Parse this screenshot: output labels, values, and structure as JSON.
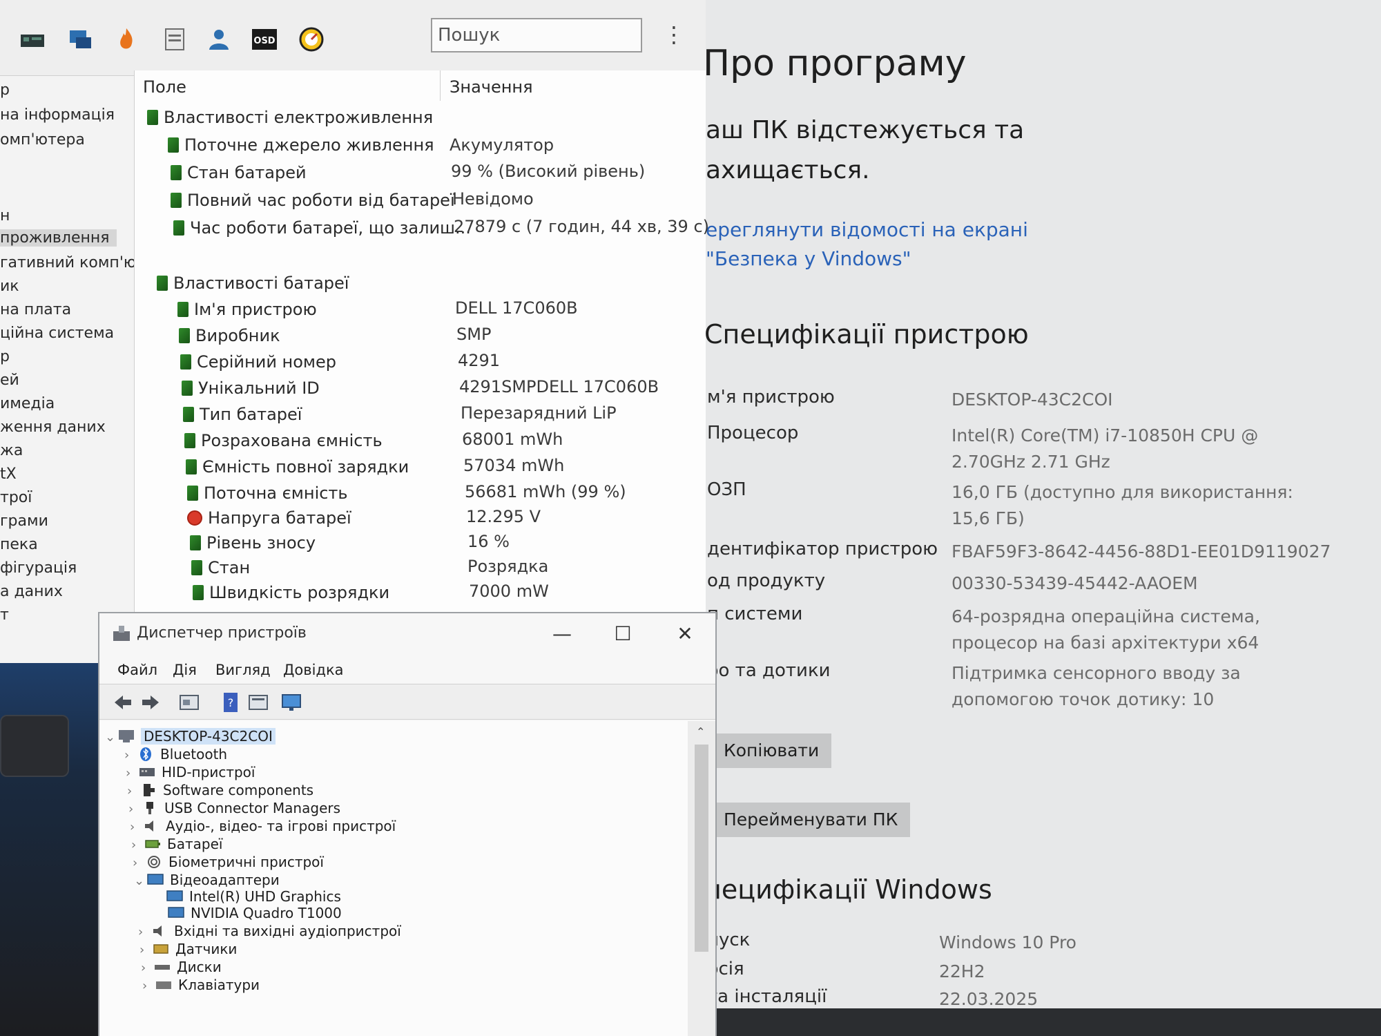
{
  "aida": {
    "search_placeholder": "Пошук",
    "nav": [
      "р",
      "на інформація",
      "омп'ютера",
      "н",
      "проживлення",
      "гативний комп'юте",
      "ик",
      "на плата",
      "ційна система",
      "р",
      "ей",
      "имедіа",
      "ження даних",
      "жа",
      "tX",
      "трої",
      "грами",
      "пека",
      "фігурація",
      "а даних",
      "т"
    ],
    "columns": {
      "field": "Поле",
      "value": "Значення"
    },
    "groups": [
      {
        "title": "Властивості електроживлення",
        "rows": [
          {
            "field": "Поточне джерело живлення",
            "value": "Акумулятор"
          },
          {
            "field": "Стан батарей",
            "value": "99 % (Високий рівень)"
          },
          {
            "field": "Повний час роботи від батареї",
            "value": "Невідомо"
          },
          {
            "field": "Час роботи батареї, що залиш...",
            "value": "27879 с (7 годин, 44 хв, 39 с)"
          }
        ]
      },
      {
        "title": "Властивості батареї",
        "rows": [
          {
            "field": "Ім'я пристрою",
            "value": "DELL 17C060B"
          },
          {
            "field": "Виробник",
            "value": "SMP"
          },
          {
            "field": "Серійний номер",
            "value": "4291"
          },
          {
            "field": "Унікальний ID",
            "value": "4291SMPDELL 17C060B"
          },
          {
            "field": "Тип батареї",
            "value": "Перезарядний LiP"
          },
          {
            "field": "Розрахована ємність",
            "value": "68001 mWh"
          },
          {
            "field": "Ємність повної зарядки",
            "value": "57034 mWh"
          },
          {
            "field": "Поточна ємність",
            "value": "56681 mWh  (99 %)"
          },
          {
            "field": "Напруга батареї",
            "value": "12.295 V"
          },
          {
            "field": "Рівень зносу",
            "value": "16 %"
          },
          {
            "field": "Стан",
            "value": "Розрядка"
          },
          {
            "field": "Швидкість розрядки",
            "value": "7000 mW"
          }
        ]
      }
    ]
  },
  "devmgr": {
    "title": "Диспетчер пристроїв",
    "menu": [
      "Файл",
      "Дія",
      "Вигляд",
      "Довідка"
    ],
    "root": "DESKTOP-43C2COI",
    "nodes": [
      "Bluetooth",
      "HID-пристрої",
      "Software components",
      "USB Connector Managers",
      "Аудіо-, відео- та ігрові пристрої",
      "Батареї",
      "Біометричні пристрої",
      "Відеоадаптери",
      "Intel(R) UHD Graphics",
      "NVIDIA Quadro T1000",
      "Вхідні та вихідні аудіопристрої",
      "Датчики",
      "Диски",
      "Клавіатури"
    ]
  },
  "settings": {
    "title": "Про програму",
    "protection": "аш ПК відстежується та ахищається.",
    "link": "ереглянути відомості на екрані \"Безпека у Vindows\"",
    "device_specs_title": "Специфікації пристрою",
    "specs": [
      {
        "label": "м'я пристрою",
        "value": "DESKTOP-43C2COI"
      },
      {
        "label": "Процесор",
        "value": "Intel(R) Core(TM) i7-10850H CPU @ 2.70GHz   2.71 GHz"
      },
      {
        "label": "ОЗП",
        "value": "16,0 ГБ (доступно для використання: 15,6 ГБ)"
      },
      {
        "label": "дентифікатор пристрою",
        "value": "FBAF59F3-8642-4456-88D1-EE01D9119027"
      },
      {
        "label": "од продукту",
        "value": "00330-53439-45442-AAOEM"
      },
      {
        "label": "п системи",
        "value": "64-розрядна операційна система, процесор на базі архітектури x64"
      },
      {
        "label": "ро та дотики",
        "value": "Підтримка сенсорного вводу за допомогою точок дотику: 10"
      }
    ],
    "copy_button": "Копіювати",
    "rename_button": "Перейменувати ПК",
    "windows_specs_title": "пецифікації Windows",
    "win_specs": [
      {
        "label": "пуск",
        "value": "Windows 10 Pro"
      },
      {
        "label": "рсія",
        "value": "22H2"
      },
      {
        "label": "та інсталяції",
        "value": "22.03.2025"
      }
    ]
  }
}
